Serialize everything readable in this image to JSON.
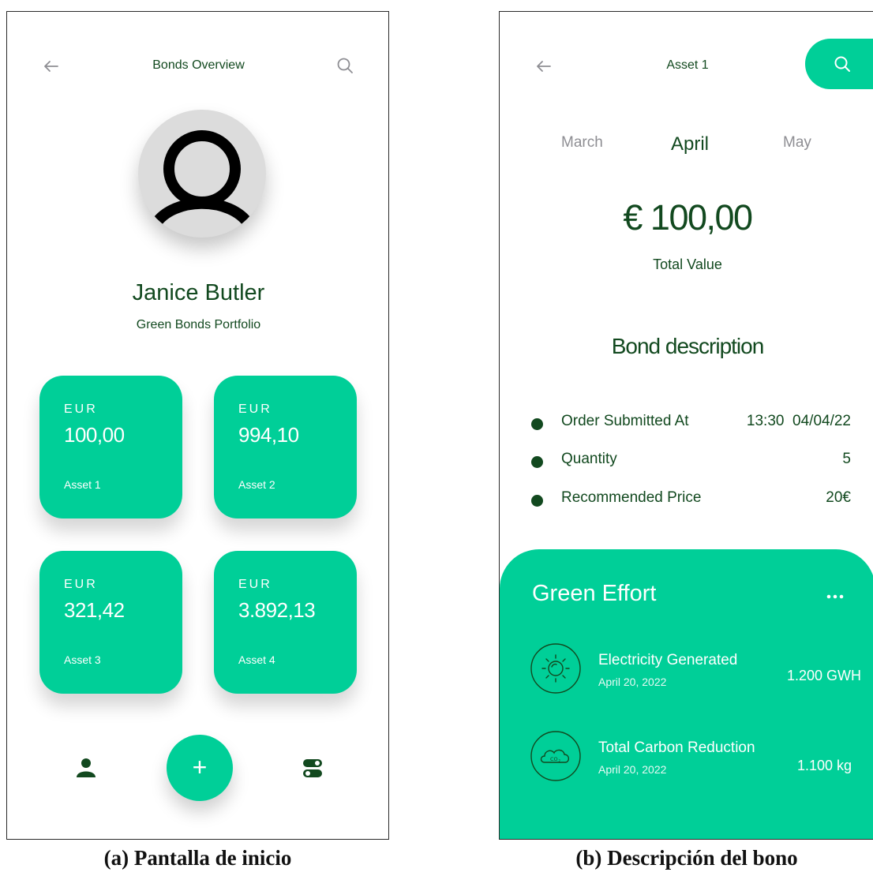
{
  "screen_a": {
    "title": "Bonds Overview",
    "icons": {
      "back": "arrow-left-icon",
      "search": "search-icon",
      "avatar": "user-icon"
    },
    "user": {
      "name": "Janice Butler",
      "subtitle": "Green Bonds Portfolio"
    },
    "assets": [
      {
        "currency": "EUR",
        "amount": "100,00",
        "name": "Asset 1"
      },
      {
        "currency": "EUR",
        "amount": "994,10",
        "name": "Asset 2"
      },
      {
        "currency": "EUR",
        "amount": "321,42",
        "name": "Asset 3"
      },
      {
        "currency": "EUR",
        "amount": "3.892,13",
        "name": "Asset 4"
      }
    ],
    "bottom_nav": {
      "add_label": "+",
      "profile_icon": "person-icon",
      "settings_icon": "toggle-icon"
    },
    "caption": "(a) Pantalla de inicio"
  },
  "screen_b": {
    "title": "Asset 1",
    "icons": {
      "back": "arrow-left-icon",
      "search": "search-icon",
      "more": "more-horizontal-icon"
    },
    "months": {
      "prev": "March",
      "current": "April",
      "next": "May"
    },
    "total": {
      "value": "€ 100,00",
      "label": "Total Value"
    },
    "bond_description": {
      "title": "Bond description",
      "rows": [
        {
          "label": "Order Submitted At",
          "value": "13:30  04/04/22"
        },
        {
          "label": "Quantity",
          "value": "5"
        },
        {
          "label": "Recommended Price",
          "value": "20€"
        }
      ]
    },
    "green_effort": {
      "title": "Green Effort",
      "items": [
        {
          "icon": "sun-icon",
          "title": "Electricity Generated",
          "date": "April 20, 2022",
          "value": "1.200 GWH"
        },
        {
          "icon": "co2-cloud-icon",
          "title": "Total Carbon Reduction",
          "date": "April 20, 2022",
          "value": "1.100 kg"
        }
      ]
    },
    "caption": "(b) Descripción del bono"
  },
  "colors": {
    "accent": "#00cf98",
    "dark_green": "#12491f",
    "muted": "#8e8e93"
  }
}
